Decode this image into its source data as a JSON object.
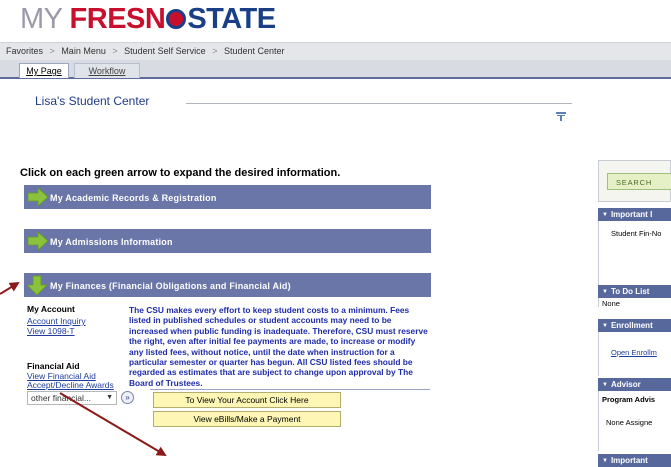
{
  "header": {
    "logo_my": "MY",
    "logo_fresno": "FRESN",
    "logo_state": "STATE"
  },
  "breadcrumb": [
    "Favorites",
    "Main Menu",
    "Student Self Service",
    "Student Center"
  ],
  "breadcrumb_sep": ">",
  "tabs": [
    {
      "label": "My Page"
    },
    {
      "label": "Workflow"
    }
  ],
  "page_title": "Lisa's Student Center",
  "instruction": "Click on each green arrow to expand the desired information.",
  "sections": [
    {
      "label": "My Academic Records & Registration"
    },
    {
      "label": "My Admissions Information"
    },
    {
      "label": "My Finances (Financial Obligations and Financial Aid)"
    }
  ],
  "finances": {
    "account_heading": "My Account",
    "account_links": [
      "Account Inquiry",
      "View 1098-T"
    ],
    "aid_heading": "Financial Aid",
    "aid_links": [
      "View Financial Aid",
      "Accept/Decline Awards"
    ],
    "notice": "The CSU makes every effort to keep student costs to a minimum. Fees listed in published schedules or student accounts may need to be increased when public funding is inadequate. Therefore, CSU must reserve the right, even after initial fee payments are made, to increase or modify any listed fees, without notice, until the date when instruction for a particular semester or quarter has begun. All CSU listed fees should be regarded as estimates that are subject to change upon approval by The Board of Trustees.",
    "select_value": "other financial...",
    "buttons": [
      "To View Your Account Click Here",
      "View eBills/Make a Payment"
    ]
  },
  "right_panel": {
    "search_label": "SEARCH",
    "headers": [
      "Important I",
      "To Do List",
      "Enrollment",
      "Advisor",
      "Important"
    ],
    "important_text": "Student Fin-No",
    "todo_text": "None",
    "enrollment_link": "Open Enrollm",
    "advisor_label": "Program Advis",
    "advisor_value": "None Assigne"
  },
  "colors": {
    "section_bar": "#6a75a8",
    "arrow_green": "#8ac23e",
    "annotation": "#8b1a1a",
    "notice_text": "#1e2ca8"
  },
  "icons": [
    "expand-arrow-icon",
    "collapse-arrow-icon",
    "personalize-icon",
    "go-icon",
    "dropdown-arrow-icon",
    "annotation-arrow-icon"
  ]
}
